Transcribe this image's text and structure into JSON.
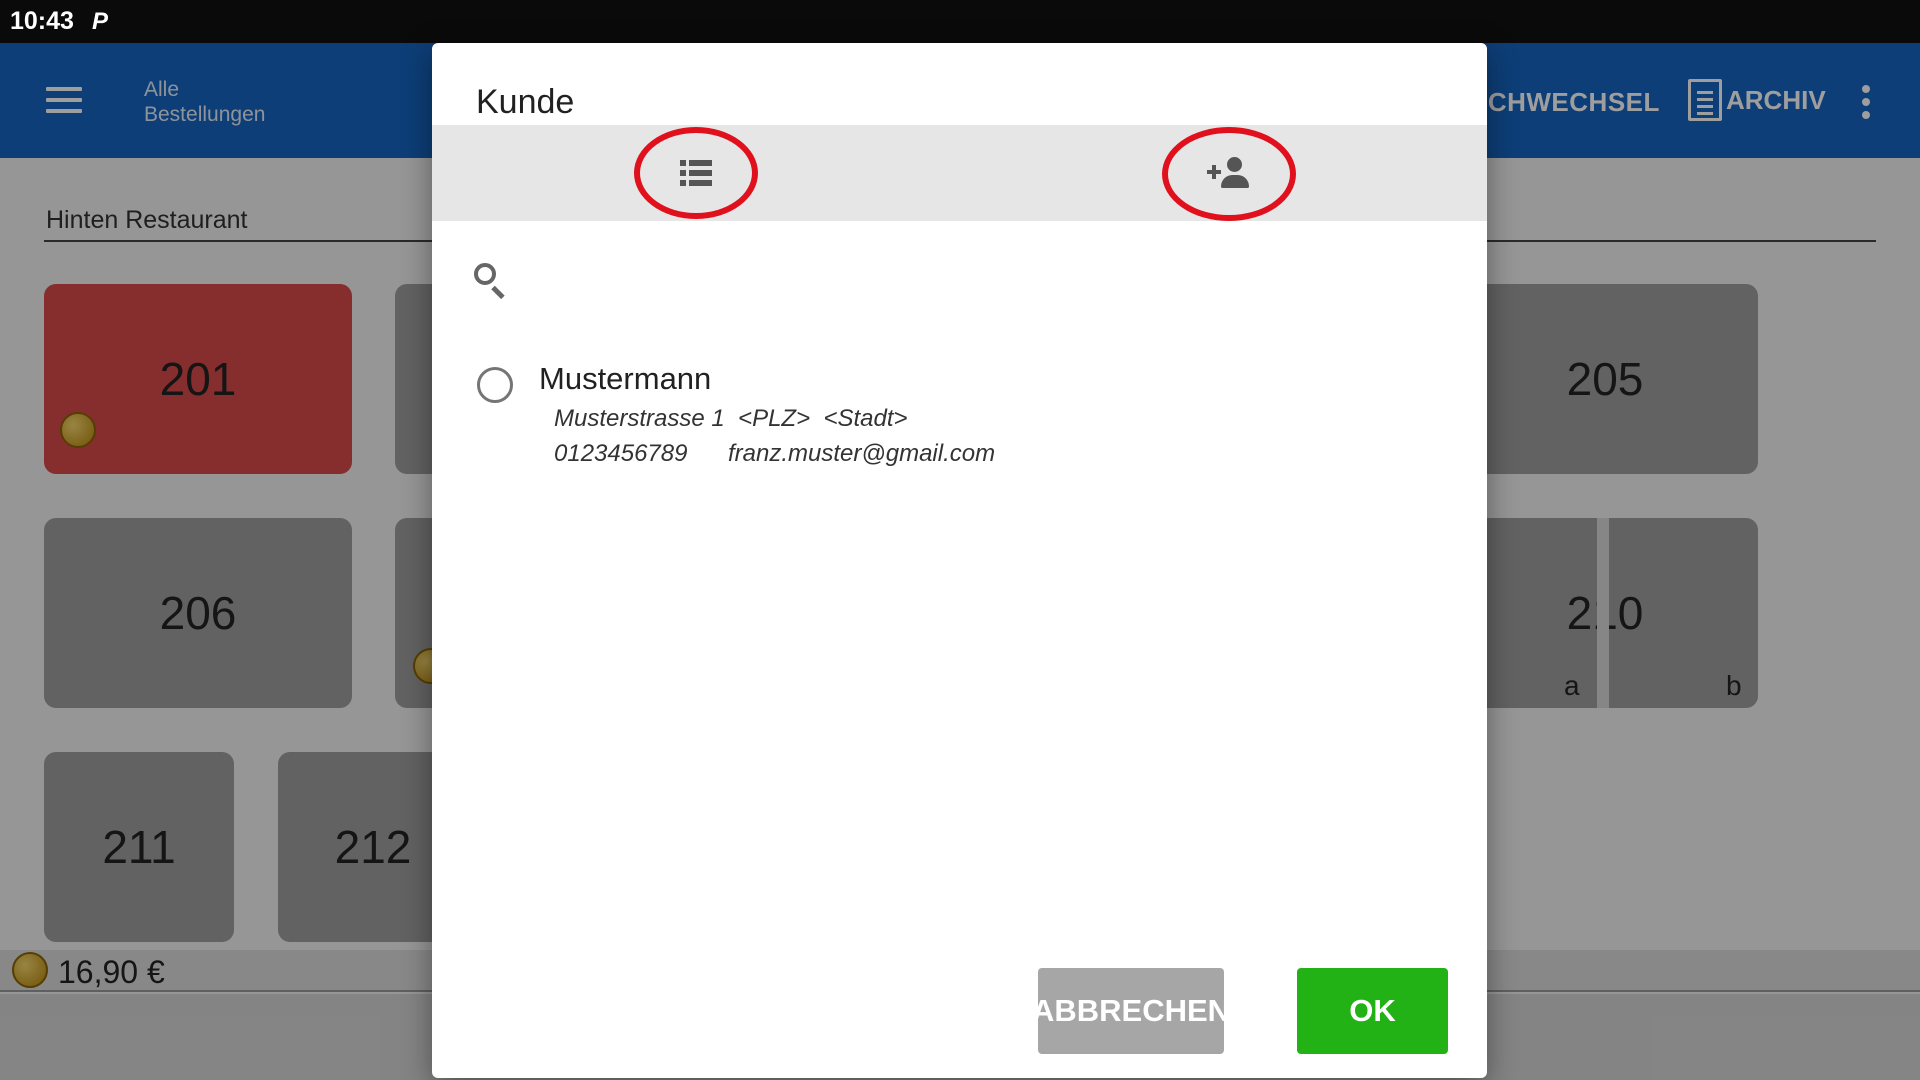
{
  "status_bar": {
    "time": "10:43",
    "notification_icon": "P"
  },
  "app_bar": {
    "subtitle_line1": "Alle",
    "subtitle_line2": "Bestellungen",
    "action_partial": "SCHWECHSEL",
    "archive_label": "ARCHIV",
    "color": "#1565c0"
  },
  "room": {
    "label": "Hinten Restaurant"
  },
  "tables": [
    {
      "number": "201",
      "state": "busy"
    },
    {
      "number": "205",
      "state": "free"
    },
    {
      "number": "206",
      "state": "free"
    },
    {
      "number": "210",
      "state": "free",
      "sub_a": "a",
      "sub_b": "b"
    },
    {
      "number": "211",
      "state": "free"
    },
    {
      "number": "212",
      "state": "free"
    }
  ],
  "total": {
    "amount": "16,90 €"
  },
  "dialog": {
    "title": "Kunde",
    "tabs": [
      {
        "icon": "list-icon",
        "highlighted": true
      },
      {
        "icon": "add-person-icon",
        "highlighted": true
      }
    ],
    "search_icon": "search-icon",
    "customers": [
      {
        "name": "Mustermann",
        "address": "Musterstrasse 1  <PLZ>  <Stadt>",
        "phone": "0123456789",
        "email": "franz.muster@gmail.com",
        "selected": false
      }
    ],
    "cancel_label": "ABBRECHEN",
    "ok_label": "OK",
    "ok_color": "#22b215",
    "highlight_color": "#e0101c"
  }
}
